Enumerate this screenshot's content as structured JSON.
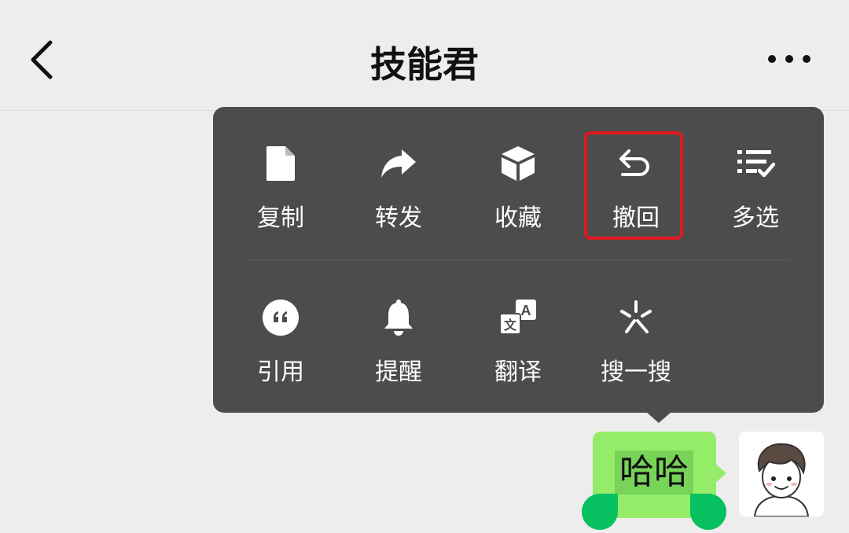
{
  "header": {
    "title": "技能君",
    "back_icon": "chevron-left-icon",
    "more_icon": "more-dots-icon"
  },
  "menu": {
    "row1": [
      {
        "label": "复制",
        "icon": "file-icon"
      },
      {
        "label": "转发",
        "icon": "share-arrow-icon"
      },
      {
        "label": "收藏",
        "icon": "cube-icon"
      },
      {
        "label": "撤回",
        "icon": "undo-arrow-icon",
        "highlighted": true
      },
      {
        "label": "多选",
        "icon": "checklist-icon"
      }
    ],
    "row2": [
      {
        "label": "引用",
        "icon": "quote-icon"
      },
      {
        "label": "提醒",
        "icon": "bell-icon"
      },
      {
        "label": "翻译",
        "icon": "translate-icon"
      },
      {
        "label": "搜一搜",
        "icon": "sparkle-search-icon"
      }
    ]
  },
  "message": {
    "text": "哈哈"
  },
  "colors": {
    "background": "#ededed",
    "popup": "#4c4c4c",
    "bubble": "#95ec69",
    "selection_handle": "#07c160",
    "highlight_border": "#e0191f"
  }
}
